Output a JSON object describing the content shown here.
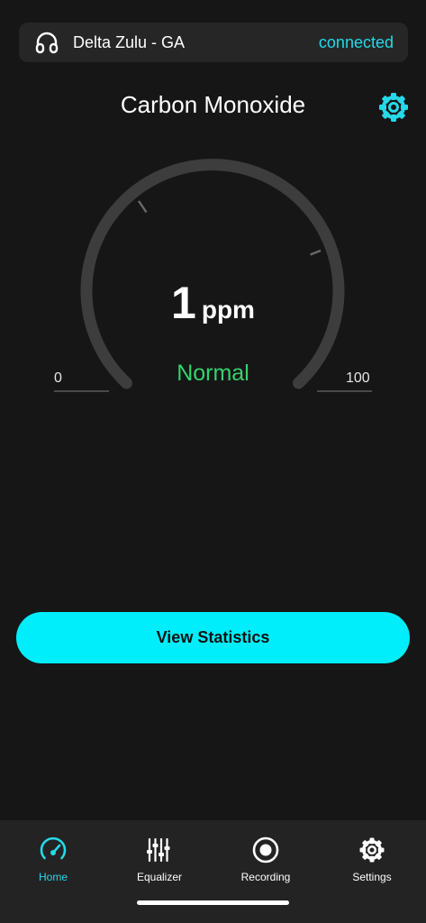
{
  "device": {
    "name": "Delta Zulu - GA",
    "status": "connected",
    "icon": "headphones-icon"
  },
  "sensor": {
    "title": "Carbon Monoxide",
    "settings_icon": "gear-icon"
  },
  "gauge": {
    "value": "1",
    "unit": "ppm",
    "status": "Normal",
    "min_label": "0",
    "max_label": "100",
    "level_fraction": 0.01
  },
  "actions": {
    "view_statistics": "View Statistics"
  },
  "tabs": [
    {
      "label": "Home",
      "icon": "speedometer-icon",
      "active": true
    },
    {
      "label": "Equalizer",
      "icon": "equalizer-icon",
      "active": false
    },
    {
      "label": "Recording",
      "icon": "record-icon",
      "active": false
    },
    {
      "label": "Settings",
      "icon": "gear-icon",
      "active": false
    }
  ],
  "colors": {
    "accent": "#26d9e8",
    "button": "#00eefc",
    "status_normal": "#35d36a",
    "background": "#161616"
  }
}
